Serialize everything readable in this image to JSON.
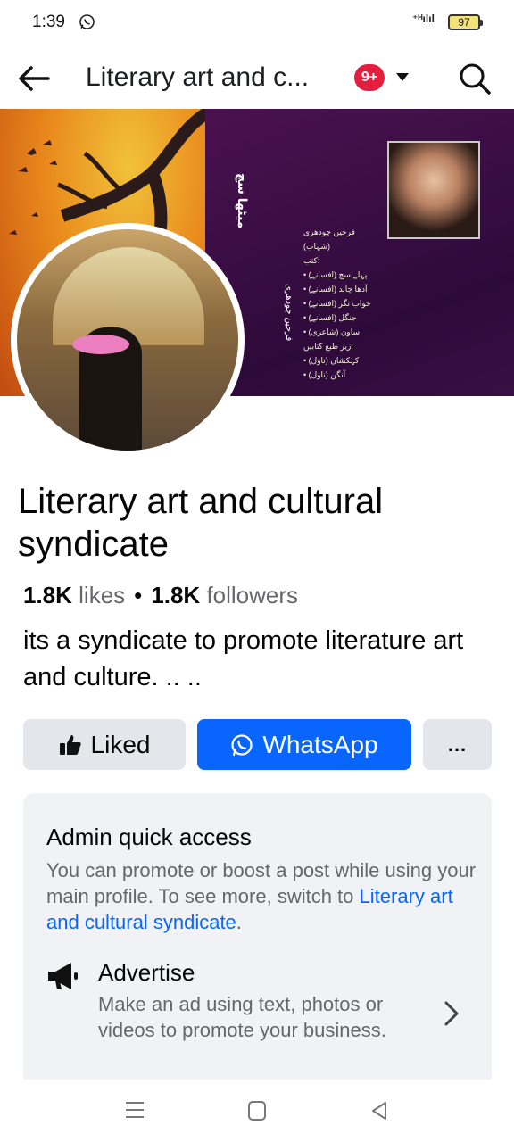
{
  "status_bar": {
    "time": "1:39",
    "battery": "97"
  },
  "top_nav": {
    "title": "Literary art and c...",
    "notification_count": "9+"
  },
  "page": {
    "name": "Literary art and cultural syndicate",
    "likes_count": "1.8K",
    "likes_label": "likes",
    "followers_count": "1.8K",
    "followers_label": "followers",
    "about": "its a syndicate to promote literature art and culture. .. .."
  },
  "actions": {
    "liked": "Liked",
    "whatsapp": "WhatsApp",
    "more": "..."
  },
  "admin_quick_access": {
    "title": "Admin quick access",
    "desc_before": "You can promote or boost a post while using your main profile. To see more, switch to ",
    "desc_link": "Literary art and cultural syndicate",
    "desc_after": ".",
    "advertise_title": "Advertise",
    "advertise_desc": "Make an ad using text, photos or videos to promote your business."
  },
  "colors": {
    "primary": "#0866ff",
    "badge": "#e41e3f",
    "secondary_text": "#65676b"
  }
}
